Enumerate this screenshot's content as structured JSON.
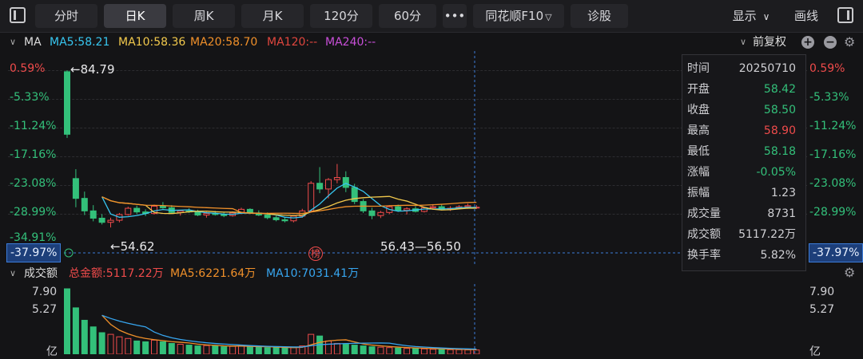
{
  "toolbar": {
    "tabs": [
      {
        "label": "分时"
      },
      {
        "label": "日K",
        "active": true
      },
      {
        "label": "周K"
      },
      {
        "label": "月K"
      },
      {
        "label": "120分"
      },
      {
        "label": "60分"
      },
      {
        "label": "•••"
      },
      {
        "label": "同花顺F10"
      },
      {
        "label": "诊股"
      }
    ],
    "display_label": "显示",
    "draw_label": "画线",
    "f10_chevron": "▽",
    "display_chevron": "∨"
  },
  "ma_legend": {
    "collapse_glyph": "∨",
    "title": "MA",
    "ma5": "MA5:58.21",
    "ma10": "MA10:58.36",
    "ma20": "MA20:58.70",
    "ma120": "MA120:--",
    "ma240": "MA240:--",
    "adjust_label": "前复权",
    "adjust_chevron": "∨",
    "colors": {
      "ma5": "#37c6f0",
      "ma10": "#f2c94c",
      "ma20": "#f0902a",
      "ma120": "#e0463e",
      "ma240": "#c84fd8"
    }
  },
  "price_axis": {
    "labels": [
      "0.59%",
      "-5.33%",
      "-11.24%",
      "-17.16%",
      "-23.08%",
      "-28.99%"
    ],
    "current_label": "-37.97%",
    "hidden_label": "-34.91%"
  },
  "annotations": {
    "high": "←84.79",
    "low": "←54.62",
    "range": "56.43—56.50",
    "bang_marker": "榜"
  },
  "info_panel": {
    "rows": [
      {
        "label": "时间",
        "value": "20250710",
        "color": "#d0d0d4"
      },
      {
        "label": "开盘",
        "value": "58.42",
        "color": "#33c07a"
      },
      {
        "label": "收盘",
        "value": "58.50",
        "color": "#33c07a"
      },
      {
        "label": "最高",
        "value": "58.90",
        "color": "#ef4b4b"
      },
      {
        "label": "最低",
        "value": "58.18",
        "color": "#33c07a"
      },
      {
        "label": "涨幅",
        "value": "-0.05%",
        "color": "#33c07a"
      },
      {
        "label": "振幅",
        "value": "1.23",
        "color": "#d0d0d4"
      },
      {
        "label": "成交量",
        "value": "8731",
        "color": "#d0d0d4"
      },
      {
        "label": "成交额",
        "value": "5117.22万",
        "color": "#d0d0d4"
      },
      {
        "label": "换手率",
        "value": "5.82%",
        "color": "#d0d0d4"
      }
    ]
  },
  "volume": {
    "collapse_glyph": "∨",
    "title": "成交额",
    "total": "总金额:5117.22万",
    "ma5": "MA5:6221.64万",
    "ma10": "MA10:7031.41万",
    "axis": [
      "7.90",
      "5.27",
      "亿"
    ],
    "colors": {
      "total": "#ef4b4b",
      "ma5": "#f0902a",
      "ma10": "#37a6f0"
    }
  },
  "chart_data": {
    "type": "candlestick",
    "price_scale": {
      "top": 84.79,
      "bottom": 50.2
    },
    "candles": [
      [
        84.5,
        84.79,
        71.8,
        72.5
      ],
      [
        64.0,
        65.8,
        58.5,
        60.2
      ],
      [
        60.2,
        61.5,
        57.0,
        57.8
      ],
      [
        57.8,
        58.9,
        55.8,
        56.4
      ],
      [
        56.4,
        57.2,
        55.2,
        55.6
      ],
      [
        55.6,
        56.5,
        54.62,
        56.0
      ],
      [
        56.0,
        57.4,
        55.6,
        57.1
      ],
      [
        57.1,
        58.6,
        56.9,
        58.3
      ],
      [
        58.3,
        58.8,
        57.2,
        57.6
      ],
      [
        57.6,
        58.1,
        56.8,
        57.3
      ],
      [
        57.3,
        59.0,
        57.1,
        58.7
      ],
      [
        58.7,
        59.5,
        58.2,
        58.4
      ],
      [
        58.4,
        58.9,
        57.3,
        57.5
      ],
      [
        57.5,
        58.0,
        56.9,
        57.8
      ],
      [
        57.8,
        58.3,
        57.4,
        57.6
      ],
      [
        57.6,
        58.0,
        56.8,
        57.0
      ],
      [
        57.0,
        57.6,
        56.5,
        57.3
      ],
      [
        57.3,
        57.8,
        56.9,
        57.1
      ],
      [
        57.1,
        57.5,
        56.6,
        56.9
      ],
      [
        56.9,
        57.7,
        56.7,
        57.4
      ],
      [
        57.4,
        58.4,
        57.2,
        58.1
      ],
      [
        58.1,
        58.3,
        57.2,
        57.4
      ],
      [
        57.4,
        57.9,
        56.8,
        57.0
      ],
      [
        57.0,
        57.5,
        56.2,
        56.5
      ],
      [
        56.5,
        56.9,
        55.8,
        56.1
      ],
      [
        56.1,
        56.6,
        55.6,
        55.9
      ],
      [
        55.9,
        57.0,
        55.6,
        56.8
      ],
      [
        56.8,
        58.2,
        56.5,
        57.8
      ],
      [
        57.8,
        63.5,
        57.5,
        63.1
      ],
      [
        63.1,
        66.2,
        61.2,
        62.0
      ],
      [
        62.0,
        64.1,
        60.2,
        63.8
      ],
      [
        63.8,
        66.8,
        63.1,
        64.2
      ],
      [
        64.2,
        65.4,
        61.4,
        62.3
      ],
      [
        62.3,
        63.0,
        59.1,
        59.6
      ],
      [
        59.6,
        60.1,
        57.4,
        57.8
      ],
      [
        57.8,
        58.4,
        56.2,
        56.9
      ],
      [
        56.9,
        57.8,
        56.43,
        57.5
      ],
      [
        57.5,
        58.9,
        57.2,
        58.6
      ],
      [
        58.6,
        59.0,
        57.6,
        57.9
      ],
      [
        57.9,
        58.5,
        57.1,
        58.2
      ],
      [
        58.2,
        58.7,
        57.5,
        57.7
      ],
      [
        57.7,
        58.6,
        57.5,
        58.4
      ],
      [
        58.4,
        59.1,
        58.0,
        58.6
      ],
      [
        58.6,
        59.0,
        57.9,
        58.1
      ],
      [
        58.1,
        58.7,
        57.8,
        58.3
      ],
      [
        58.3,
        58.9,
        58.1,
        58.6
      ],
      [
        58.6,
        59.2,
        58.2,
        58.8
      ],
      [
        58.42,
        58.9,
        58.18,
        58.5
      ]
    ],
    "volumes": [
      7.9,
      5.6,
      4.1,
      3.3,
      2.6,
      2.4,
      2.1,
      1.9,
      1.6,
      1.5,
      1.7,
      1.5,
      1.3,
      1.2,
      1.1,
      1.0,
      1.05,
      1.0,
      0.9,
      0.95,
      1.0,
      0.9,
      0.85,
      0.8,
      0.8,
      0.75,
      0.8,
      1.0,
      2.4,
      2.2,
      1.6,
      1.3,
      1.2,
      1.1,
      1.0,
      0.9,
      0.85,
      0.8,
      0.75,
      0.7,
      0.7,
      0.65,
      0.6,
      0.6,
      0.55,
      0.55,
      0.52,
      0.51
    ],
    "volume_max": 7.9
  }
}
